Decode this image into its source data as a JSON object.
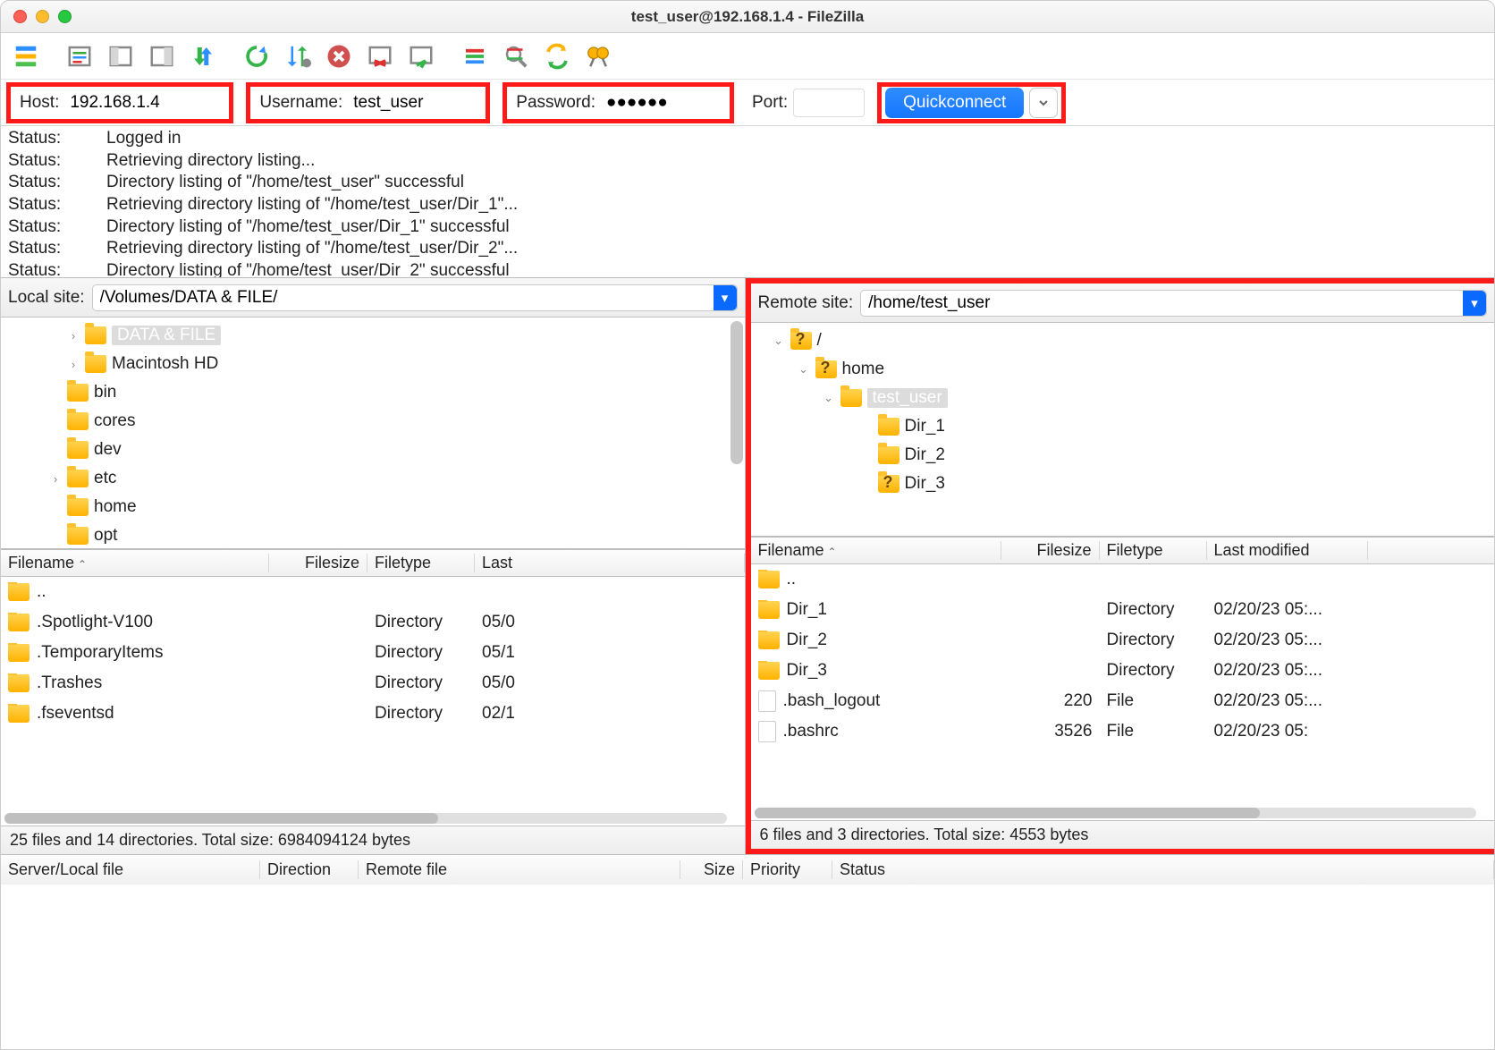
{
  "window": {
    "title": "test_user@192.168.1.4 - FileZilla"
  },
  "quickbar": {
    "host_label": "Host:",
    "host_value": "192.168.1.4",
    "user_label": "Username:",
    "user_value": "test_user",
    "pass_label": "Password:",
    "pass_value": "●●●●●●",
    "port_label": "Port:",
    "port_value": "",
    "connect_label": "Quickconnect"
  },
  "log": [
    {
      "label": "Status:",
      "msg": "Logged in"
    },
    {
      "label": "Status:",
      "msg": "Retrieving directory listing..."
    },
    {
      "label": "Status:",
      "msg": "Directory listing of \"/home/test_user\" successful"
    },
    {
      "label": "Status:",
      "msg": "Retrieving directory listing of \"/home/test_user/Dir_1\"..."
    },
    {
      "label": "Status:",
      "msg": "Directory listing of \"/home/test_user/Dir_1\" successful"
    },
    {
      "label": "Status:",
      "msg": "Retrieving directory listing of \"/home/test_user/Dir_2\"..."
    },
    {
      "label": "Status:",
      "msg": "Directory listing of \"/home/test_user/Dir_2\" successful"
    }
  ],
  "local": {
    "label": "Local site:",
    "path": "/Volumes/DATA & FILE/",
    "tree": [
      {
        "indent": 70,
        "disc": "›",
        "name": "DATA & FILE",
        "selected": true
      },
      {
        "indent": 70,
        "disc": "›",
        "name": "Macintosh HD"
      },
      {
        "indent": 50,
        "name": "bin"
      },
      {
        "indent": 50,
        "name": "cores"
      },
      {
        "indent": 50,
        "name": "dev"
      },
      {
        "indent": 50,
        "disc": "›",
        "name": "etc"
      },
      {
        "indent": 50,
        "name": "home"
      },
      {
        "indent": 50,
        "name": "opt"
      }
    ],
    "headers": {
      "name": "Filename",
      "size": "Filesize",
      "type": "Filetype",
      "mod": "Last"
    },
    "files": [
      {
        "name": "..",
        "type": "",
        "mod": ""
      },
      {
        "name": ".Spotlight-V100",
        "type": "Directory",
        "mod": "05/0"
      },
      {
        "name": ".TemporaryItems",
        "type": "Directory",
        "mod": "05/1"
      },
      {
        "name": ".Trashes",
        "type": "Directory",
        "mod": "05/0"
      },
      {
        "name": ".fseventsd",
        "type": "Directory",
        "mod": "02/1"
      }
    ],
    "status": "25 files and 14 directories. Total size: 6984094124 bytes"
  },
  "remote": {
    "label": "Remote site:",
    "path": "/home/test_user",
    "tree": [
      {
        "indent": 20,
        "disc": "⌄",
        "unknown": true,
        "name": "/"
      },
      {
        "indent": 48,
        "disc": "⌄",
        "unknown": true,
        "name": "home"
      },
      {
        "indent": 76,
        "disc": "⌄",
        "name": "test_user",
        "selected": true
      },
      {
        "indent": 118,
        "name": "Dir_1"
      },
      {
        "indent": 118,
        "name": "Dir_2"
      },
      {
        "indent": 118,
        "unknown": true,
        "name": "Dir_3"
      }
    ],
    "headers": {
      "name": "Filename",
      "size": "Filesize",
      "type": "Filetype",
      "mod": "Last modified"
    },
    "files": [
      {
        "name": "..",
        "type": "",
        "mod": ""
      },
      {
        "name": "Dir_1",
        "type": "Directory",
        "mod": "02/20/23 05:..."
      },
      {
        "name": "Dir_2",
        "type": "Directory",
        "mod": "02/20/23 05:..."
      },
      {
        "name": "Dir_3",
        "type": "Directory",
        "mod": "02/20/23 05:..."
      },
      {
        "name": ".bash_logout",
        "size": "220",
        "type": "File",
        "mod": "02/20/23 05:...",
        "isfile": true
      },
      {
        "name": ".bashrc",
        "size": "3526",
        "type": "File",
        "mod": "02/20/23 05:",
        "isfile": true
      }
    ],
    "status": "6 files and 3 directories. Total size: 4553 bytes"
  },
  "queue": {
    "cols": {
      "server": "Server/Local file",
      "dir": "Direction",
      "remote": "Remote file",
      "size": "Size",
      "prio": "Priority",
      "status": "Status"
    }
  }
}
